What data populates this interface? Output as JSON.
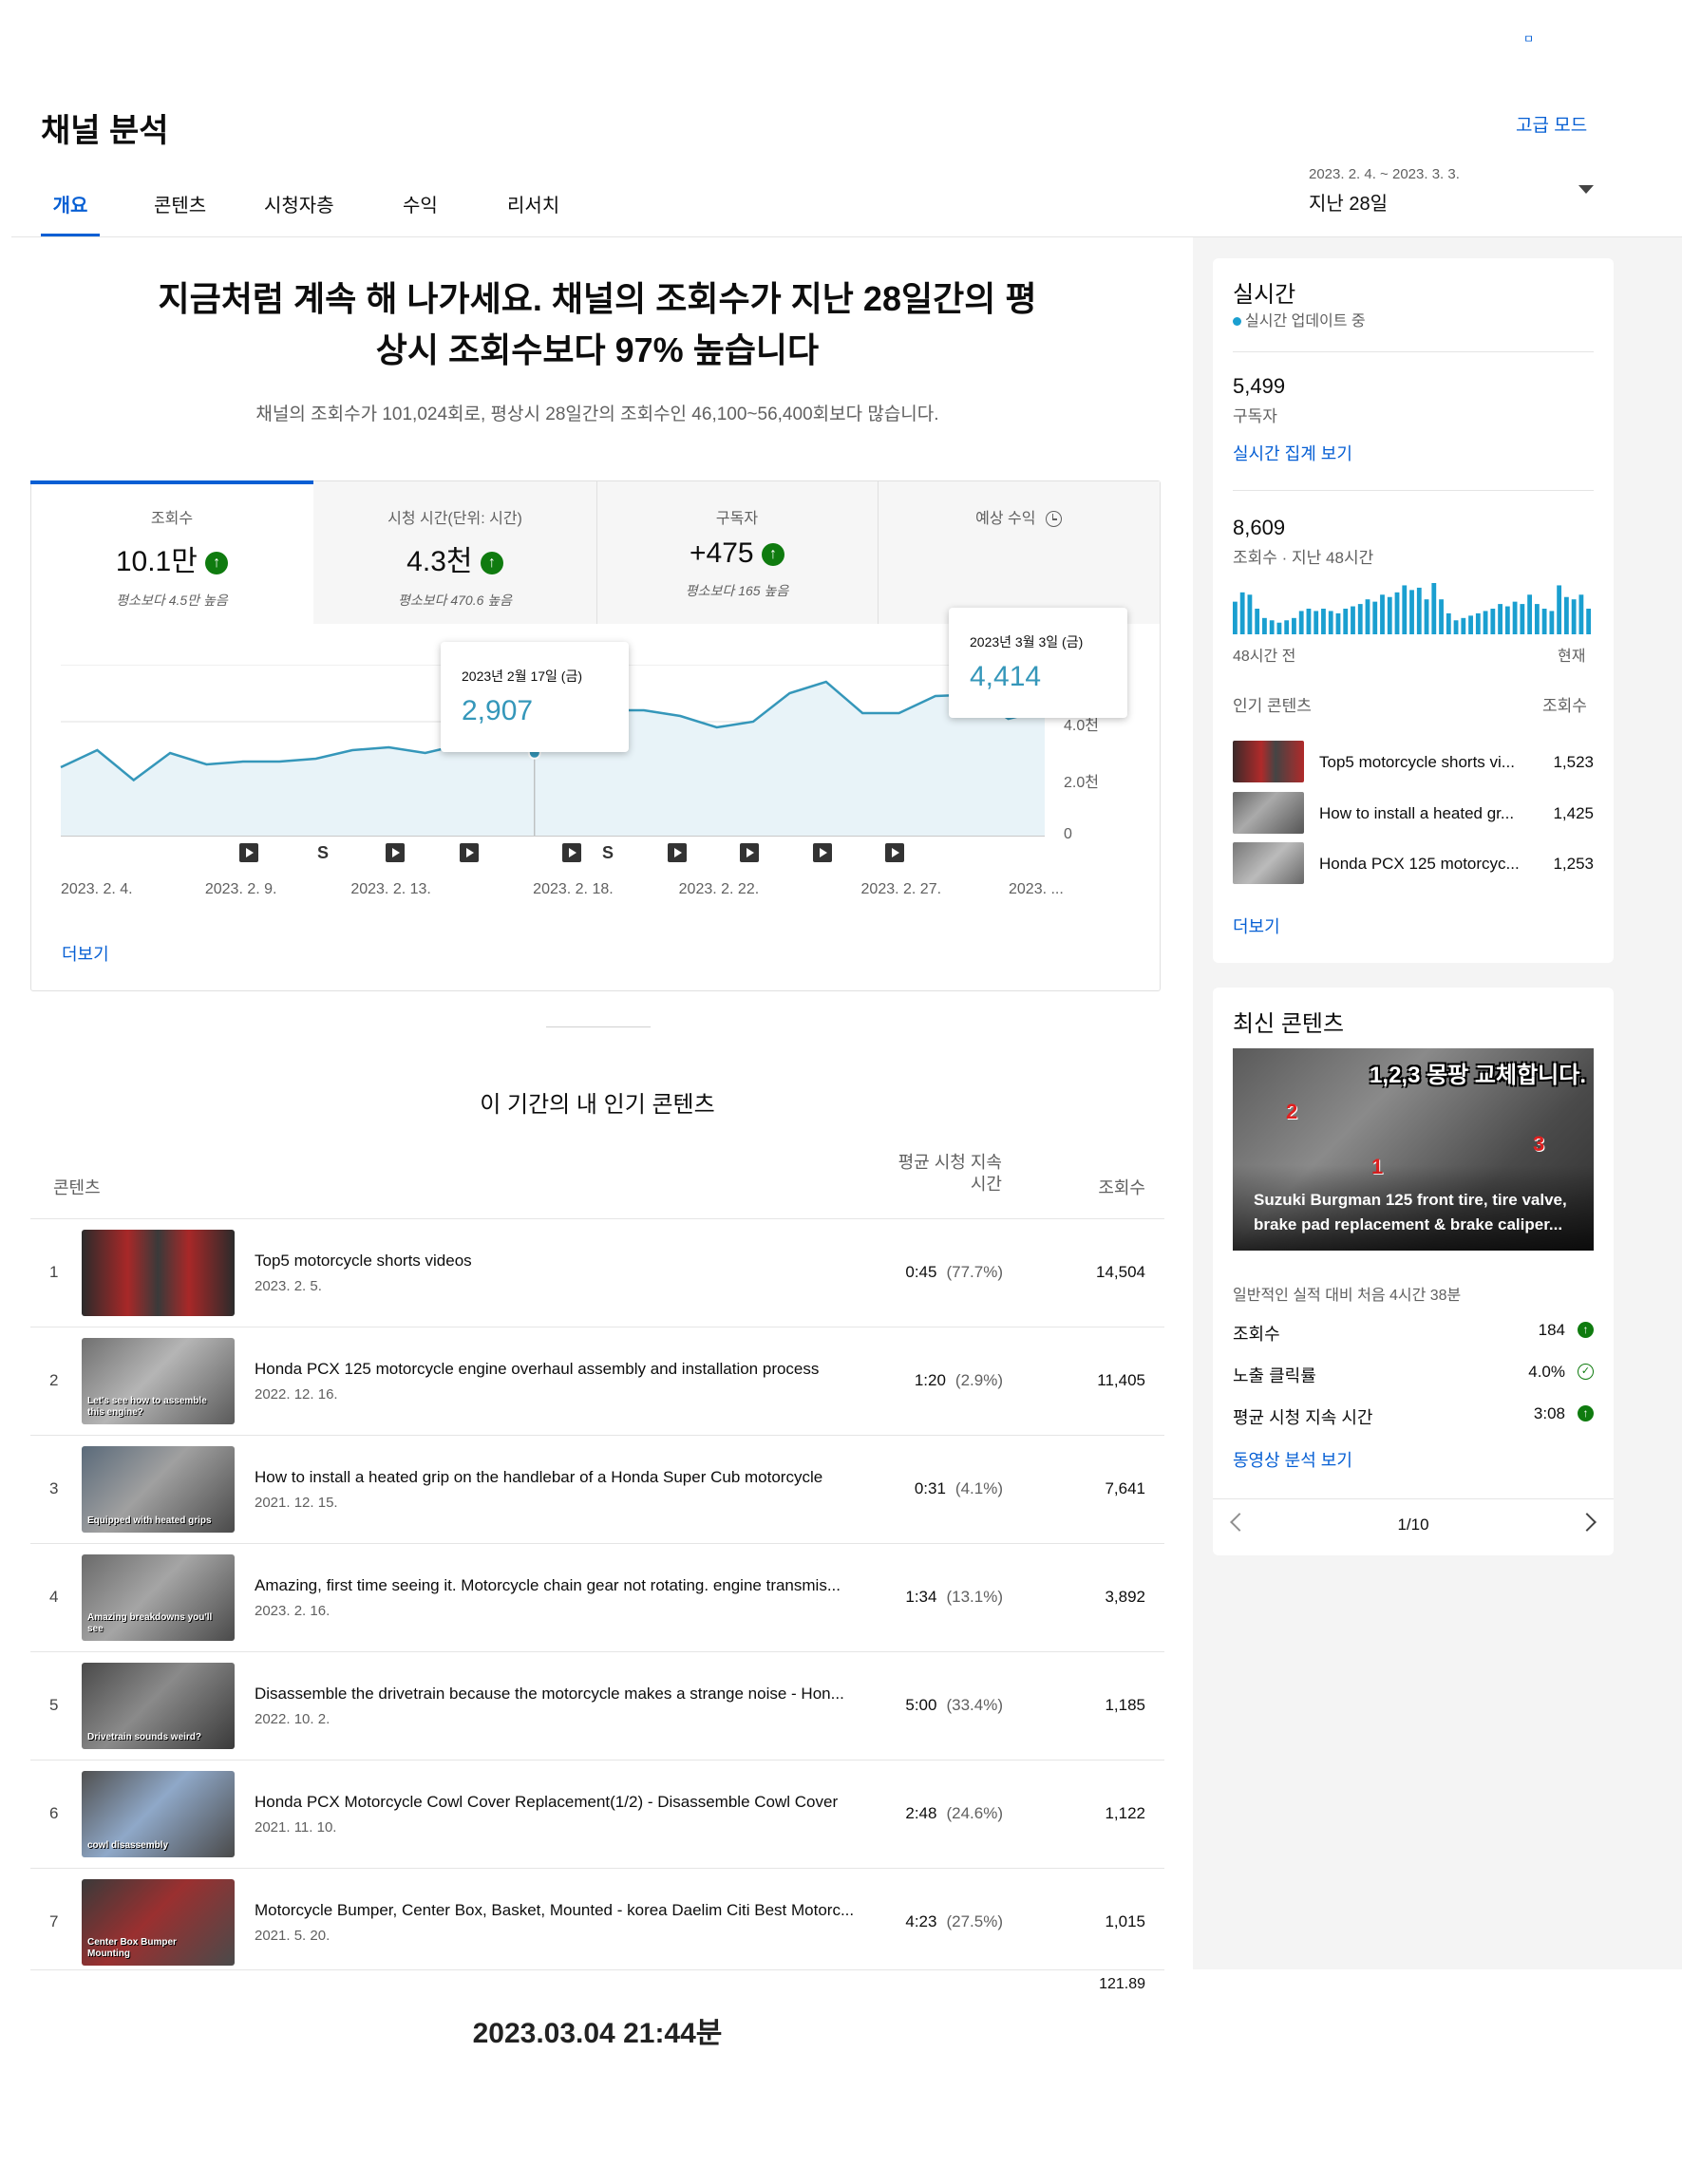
{
  "header": {
    "title": "채널 분석",
    "advanced_mode": "고급 모드",
    "date_range": "2023. 2. 4. ~ 2023. 3. 3.",
    "period_label": "지난 28일",
    "top_right_mark": "ㅁ"
  },
  "tabs": [
    {
      "label": "개요",
      "active": true
    },
    {
      "label": "콘텐츠",
      "active": false
    },
    {
      "label": "시청자층",
      "active": false
    },
    {
      "label": "수익",
      "active": false
    },
    {
      "label": "리서치",
      "active": false
    }
  ],
  "headline": {
    "line1": "지금처럼 계속 해 나가세요. 채널의 조회수가 지난 28일간의 평",
    "line2": "상시 조회수보다 97% 높습니다",
    "subtext": "채널의 조회수가 101,024회로, 평상시 28일간의 조회수인 46,100~56,400회보다 많습니다."
  },
  "metrics": [
    {
      "label": "조회수",
      "value": "10.1만",
      "sub": "평소보다 4.5만 높음",
      "arrow": "↑"
    },
    {
      "label": "시청 시간(단위: 시간)",
      "value": "4.3천",
      "sub": "평소보다 470.6 높음",
      "arrow": "↑"
    },
    {
      "label": "구독자",
      "value": "+475",
      "sub": "평소보다 165 높음",
      "arrow": "↑"
    },
    {
      "label": "예상 수익",
      "value": "",
      "sub": "",
      "icon": "clock-icon"
    }
  ],
  "chart_data": {
    "type": "area",
    "x": [
      "2023. 2. 4.",
      "2023. 2. 5.",
      "2023. 2. 6.",
      "2023. 2. 7.",
      "2023. 2. 8.",
      "2023. 2. 9.",
      "2023. 2. 10.",
      "2023. 2. 11.",
      "2023. 2. 12.",
      "2023. 2. 13.",
      "2023. 2. 14.",
      "2023. 2. 15.",
      "2023. 2. 16.",
      "2023. 2. 17.",
      "2023. 2. 18.",
      "2023. 2. 19.",
      "2023. 2. 20.",
      "2023. 2. 21.",
      "2023. 2. 22.",
      "2023. 2. 23.",
      "2023. 2. 24.",
      "2023. 2. 25.",
      "2023. 2. 26.",
      "2023. 2. 27.",
      "2023. 2. 28.",
      "2023. 3. 1.",
      "2023. 3. 2.",
      "2023. 3. 3."
    ],
    "values": [
      2400,
      3000,
      1950,
      2900,
      2500,
      2600,
      2600,
      2700,
      3000,
      3100,
      2900,
      3200,
      3500,
      2907,
      4200,
      4400,
      4400,
      4200,
      3800,
      4000,
      5000,
      5400,
      4300,
      4300,
      4900,
      4950,
      4100,
      4414
    ],
    "x_tick_labels": [
      "2023. 2. 4.",
      "2023. 2. 9.",
      "2023. 2. 13.",
      "2023. 2. 18.",
      "2023. 2. 22.",
      "2023. 2. 27.",
      "2023. ..."
    ],
    "y_tick_labels": [
      "4.0천",
      "2.0천",
      "0"
    ],
    "ylim": [
      0,
      6000
    ],
    "grid": true,
    "tooltips": [
      {
        "date": "2023년 2월 17일 (금)",
        "value": "2,907"
      },
      {
        "date": "2023년 3월 3일 (금)",
        "value": "4,414"
      }
    ],
    "markers": [
      "play",
      "short",
      "play",
      "play",
      "play",
      "short",
      "play",
      "play",
      "play",
      "play"
    ],
    "line_color": "#3597ba",
    "fill_color": "#e8f3f8"
  },
  "chart_more": "더보기",
  "top_content": {
    "heading": "이 기간의 내 인기 콘텐츠",
    "col_content": "콘텐츠",
    "col_avg_line1": "평균 시청 지속",
    "col_avg_line2": "시간",
    "col_views": "조회수",
    "rows": [
      {
        "rank": "1",
        "title": "Top5 motorcycle shorts videos",
        "date": "2023. 2. 5.",
        "dur": "0:45",
        "pct": "(77.7%)",
        "views": "14,504"
      },
      {
        "rank": "2",
        "title": "Honda PCX 125 motorcycle engine overhaul assembly and installation process",
        "date": "2022. 12. 16.",
        "dur": "1:20",
        "pct": "(2.9%)",
        "views": "11,405"
      },
      {
        "rank": "3",
        "title": "How to install a heated grip on the handlebar of a Honda Super Cub motorcycle",
        "date": "2021. 12. 15.",
        "dur": "0:31",
        "pct": "(4.1%)",
        "views": "7,641"
      },
      {
        "rank": "4",
        "title": "Amazing, first time seeing it. Motorcycle chain gear not rotating. engine transmis...",
        "date": "2023. 2. 16.",
        "dur": "1:34",
        "pct": "(13.1%)",
        "views": "3,892"
      },
      {
        "rank": "5",
        "title": "Disassemble the drivetrain because the motorcycle makes a strange noise - Hon...",
        "date": "2022. 10. 2.",
        "dur": "5:00",
        "pct": "(33.4%)",
        "views": "1,185"
      },
      {
        "rank": "6",
        "title": "Honda PCX Motorcycle Cowl Cover Replacement(1/2) - Disassemble Cowl Cover",
        "date": "2021. 11. 10.",
        "dur": "2:48",
        "pct": "(24.6%)",
        "views": "1,122"
      },
      {
        "rank": "7",
        "title": "Motorcycle Bumper, Center Box, Basket, Mounted - korea Daelim Citi Best Motorc...",
        "date": "2021. 5. 20.",
        "dur": "4:23",
        "pct": "(27.5%)",
        "views": "1,015"
      }
    ],
    "footer_value": "121.89",
    "thumb_texts": [
      "",
      "Let's see how to assemble this engine?",
      "Equipped with heated grips",
      "Amazing breakdowns you'll see",
      "Drivetrain sounds weird?",
      "cowl disassembly",
      "Center Box Bumper Mounting"
    ]
  },
  "realtime": {
    "title": "실시간",
    "updating": "실시간 업데이트 중",
    "subscribers_value": "5,499",
    "subscribers_label": "구독자",
    "realtime_link": "실시간 집계 보기",
    "views_value": "8,609",
    "views_label": "조회수 · 지난 48시간",
    "bars": [
      28,
      36,
      34,
      22,
      14,
      12,
      10,
      12,
      14,
      20,
      22,
      20,
      22,
      20,
      18,
      22,
      24,
      26,
      30,
      28,
      34,
      32,
      36,
      42,
      38,
      40,
      30,
      44,
      30,
      18,
      12,
      14,
      16,
      18,
      20,
      22,
      26,
      24,
      28,
      26,
      34,
      26,
      22,
      20,
      42,
      32,
      30,
      34,
      22
    ],
    "axis_left": "48시간 전",
    "axis_right": "현재",
    "popular_label": "인기 콘텐츠",
    "popular_views_label": "조회수",
    "popular": [
      {
        "title": "Top5 motorcycle shorts vi...",
        "views": "1,523"
      },
      {
        "title": "How to install a heated gr...",
        "views": "1,425"
      },
      {
        "title": "Honda PCX 125 motorcyc...",
        "views": "1,253"
      }
    ],
    "more": "더보기",
    "accent": "#1a9fd0"
  },
  "latest": {
    "title": "최신 콘텐츠",
    "thumb_banner": "1,2,3 몽팡 교체합니다.",
    "thumb_caption": "Suzuki Burgman 125 front tire, tire valve, brake pad replacement & brake caliper...",
    "thumb_numbers": [
      "1",
      "2",
      "3"
    ],
    "perf_note": "일반적인 실적 대비 처음 4시간 38분",
    "stats": [
      {
        "label": "조회수",
        "value": "184",
        "icon": "arrow-up-icon"
      },
      {
        "label": "노출 클릭률",
        "value": "4.0%",
        "icon": "check-circle-icon"
      },
      {
        "label": "평균 시청 지속 시간",
        "value": "3:08",
        "icon": "arrow-up-icon"
      }
    ],
    "analytics_link": "동영상 분석 보기",
    "pager": "1/10"
  },
  "timestamp": "2023.03.04 21:44분"
}
